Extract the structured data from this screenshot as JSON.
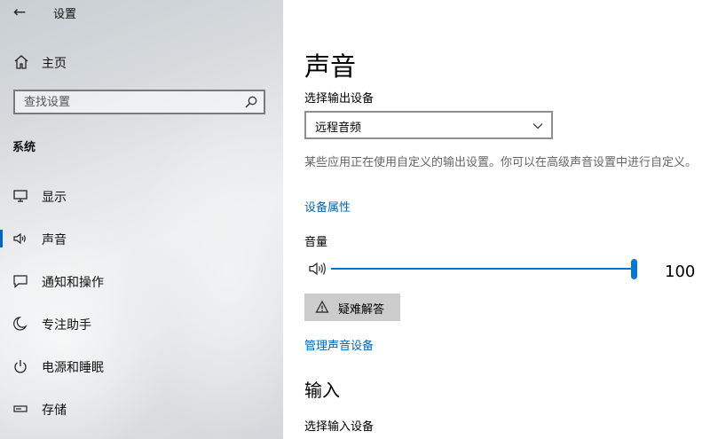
{
  "window": {
    "title": "设置"
  },
  "sidebar": {
    "home_label": "主页",
    "search_placeholder": "查找设置",
    "section_title": "系统",
    "items": [
      {
        "label": "显示",
        "icon": "monitor-icon"
      },
      {
        "label": "声音",
        "icon": "speaker-icon",
        "selected": true
      },
      {
        "label": "通知和操作",
        "icon": "notification-icon"
      },
      {
        "label": "专注助手",
        "icon": "moon-icon"
      },
      {
        "label": "电源和睡眠",
        "icon": "power-icon"
      },
      {
        "label": "存储",
        "icon": "storage-icon"
      }
    ]
  },
  "main": {
    "title": "声音",
    "output_label": "选择输出设备",
    "output_device": "远程音频",
    "description": "某些应用正在使用自定义的输出设置。你可以在高级声音设置中进行自定义。",
    "device_properties_link": "设备属性",
    "volume_label": "音量",
    "volume_value": "100",
    "volume_level": 1.0,
    "troubleshoot_label": "疑难解答",
    "manage_devices_link": "管理声音设备",
    "input_title": "输入",
    "input_label": "选择输入设备"
  },
  "colors": {
    "accent": "#0078d4",
    "link": "#0067b8",
    "button_bg": "#cccccc"
  }
}
